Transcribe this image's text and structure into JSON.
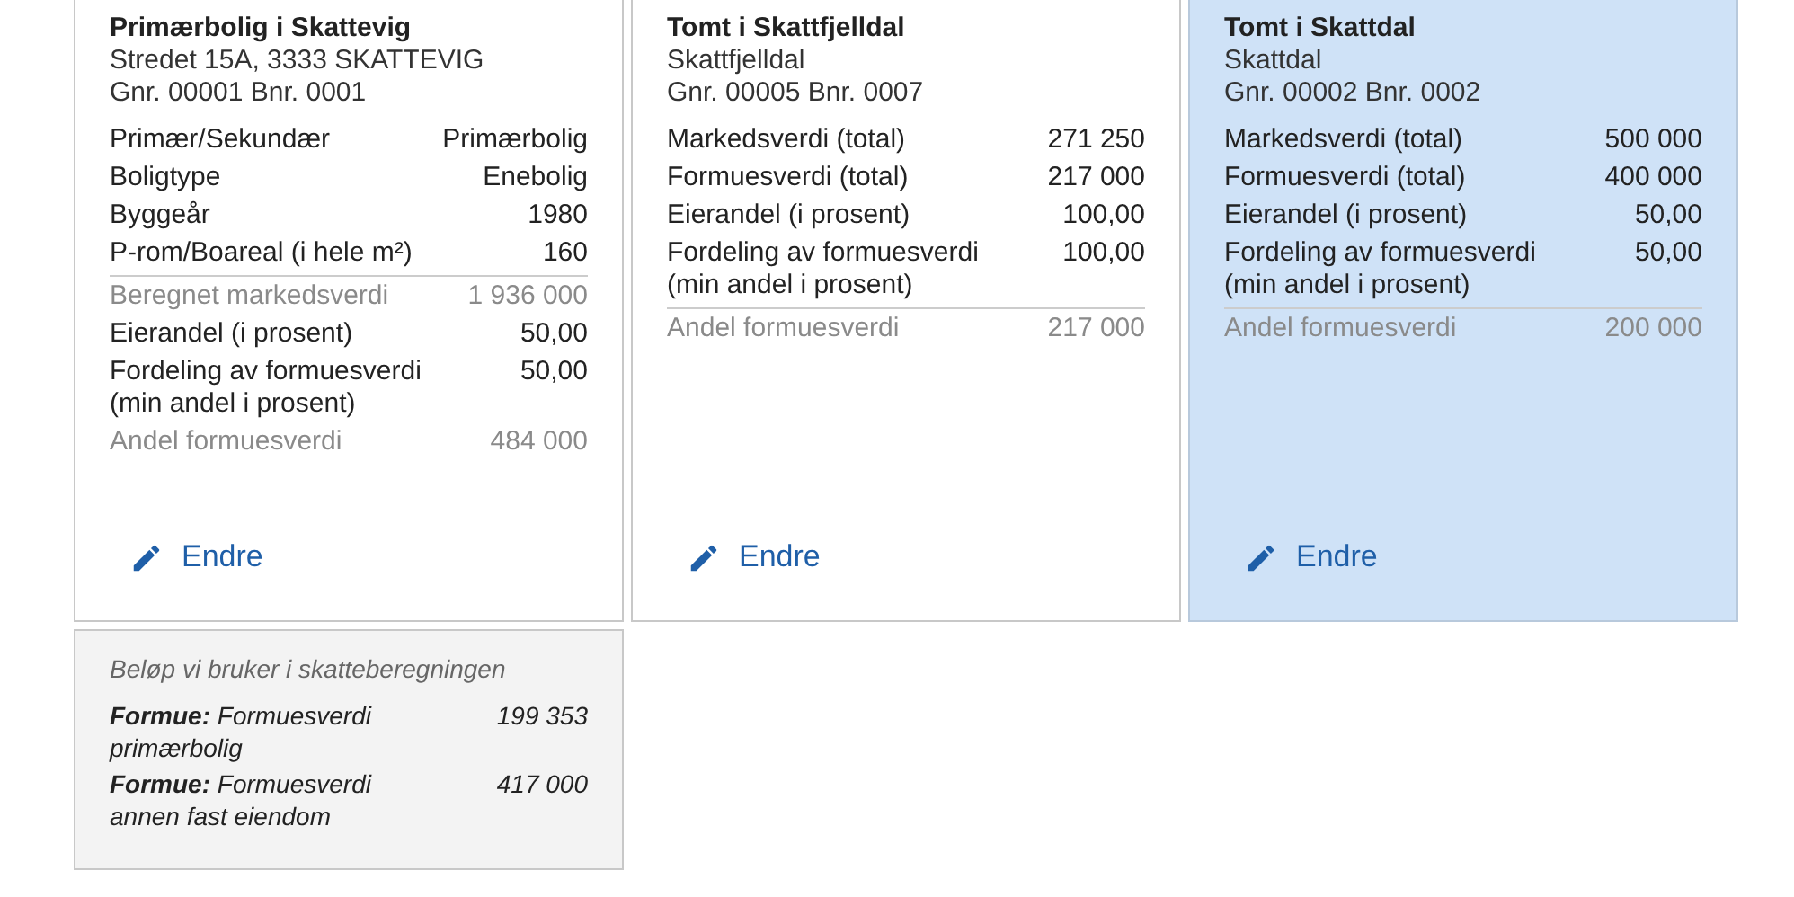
{
  "properties": [
    {
      "title": "Primærbolig i Skattevig",
      "address": "Stredet 15A, 3333 SKATTEVIG",
      "cadastre": "Gnr. 00001 Bnr. 0001",
      "selected": false,
      "edit_label": "Endre",
      "rows": [
        {
          "label": "Primær/Sekundær",
          "value": "Primærbolig",
          "muted": false,
          "divider": false
        },
        {
          "label": "Boligtype",
          "value": "Enebolig",
          "muted": false,
          "divider": false
        },
        {
          "label": "Byggeår",
          "value": "1980",
          "muted": false,
          "divider": false
        },
        {
          "label": "P-rom/Boareal (i hele m²)",
          "value": "160",
          "muted": false,
          "divider": false
        },
        {
          "label": "Beregnet markedsverdi",
          "value": "1 936 000",
          "muted": true,
          "divider": true
        },
        {
          "label": "Eierandel (i prosent)",
          "value": "50,00",
          "muted": false,
          "divider": false
        },
        {
          "label": "Fordeling av formuesverdi (min andel i prosent)",
          "value": "50,00",
          "muted": false,
          "divider": false
        },
        {
          "label": "Andel formuesverdi",
          "value": "484 000",
          "muted": true,
          "divider": false
        }
      ]
    },
    {
      "title": "Tomt i Skattfjelldal",
      "address": "Skattfjelldal",
      "cadastre": "Gnr. 00005 Bnr. 0007",
      "selected": false,
      "edit_label": "Endre",
      "rows": [
        {
          "label": "Markedsverdi (total)",
          "value": "271 250",
          "muted": false,
          "divider": false
        },
        {
          "label": "Formuesverdi (total)",
          "value": "217 000",
          "muted": false,
          "divider": false
        },
        {
          "label": "Eierandel (i prosent)",
          "value": "100,00",
          "muted": false,
          "divider": false
        },
        {
          "label": "Fordeling av formuesverdi (min andel i prosent)",
          "value": "100,00",
          "muted": false,
          "divider": false
        },
        {
          "label": "Andel formuesverdi",
          "value": "217 000",
          "muted": true,
          "divider": true
        }
      ]
    },
    {
      "title": "Tomt i Skattdal",
      "address": "Skattdal",
      "cadastre": "Gnr. 00002 Bnr. 0002",
      "selected": true,
      "edit_label": "Endre",
      "rows": [
        {
          "label": "Markedsverdi (total)",
          "value": "500 000",
          "muted": false,
          "divider": false
        },
        {
          "label": "Formuesverdi (total)",
          "value": "400 000",
          "muted": false,
          "divider": false
        },
        {
          "label": "Eierandel (i prosent)",
          "value": "50,00",
          "muted": false,
          "divider": false
        },
        {
          "label": "Fordeling av formuesverdi (min andel i prosent)",
          "value": "50,00",
          "muted": false,
          "divider": false
        },
        {
          "label": "Andel formuesverdi",
          "value": "200 000",
          "muted": true,
          "divider": true
        }
      ]
    }
  ],
  "summary": {
    "heading": "Beløp vi bruker i skatteberegningen",
    "rows": [
      {
        "label": "**Formue:** Formuesverdi primærbolig",
        "value": "199 353"
      },
      {
        "label": "**Formue:** Formuesverdi annen fast eiendom",
        "value": "417 000"
      }
    ]
  }
}
